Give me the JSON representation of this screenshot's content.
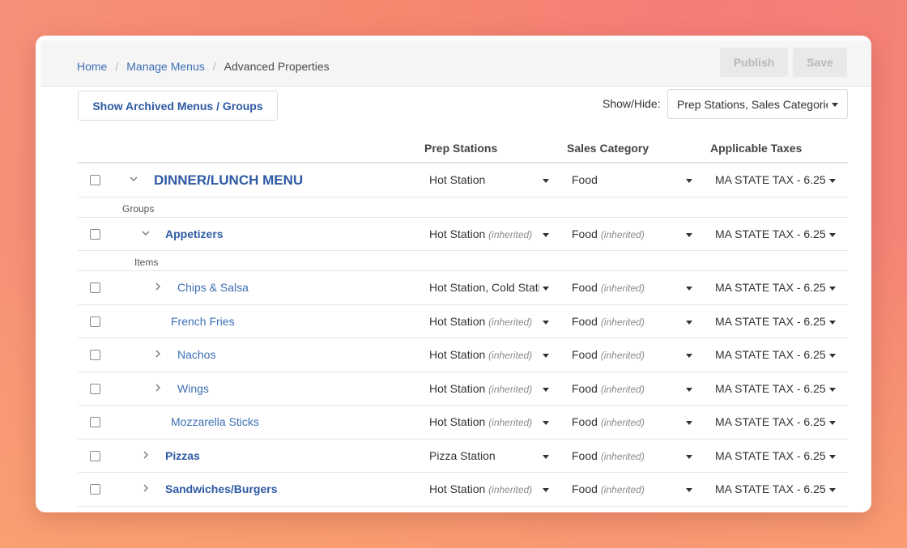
{
  "breadcrumb": {
    "home": "Home",
    "manage_menus": "Manage Menus",
    "current": "Advanced Properties",
    "separator": "/"
  },
  "toolbar": {
    "publish_label": "Publish",
    "save_label": "Save",
    "show_archived_label": "Show Archived Menus / Groups",
    "show_hide_label": "Show/Hide:",
    "show_hide_value": "Prep Stations, Sales Categories"
  },
  "columns": {
    "prep": "Prep Stations",
    "sales": "Sales Category",
    "taxes": "Applicable Taxes"
  },
  "inherited_label": "(inherited)",
  "rows": [
    {
      "type": "item",
      "level": 0,
      "name": "DINNER/LUNCH MENU",
      "chevron": "down",
      "prep": "Hot Station",
      "prep_inh": false,
      "sales": "Food",
      "sales_inh": false,
      "tax": "MA STATE TAX - 6.25%"
    },
    {
      "type": "sub",
      "level": 0,
      "label": "Groups"
    },
    {
      "type": "item",
      "level": 1,
      "name": "Appetizers",
      "chevron": "down",
      "prep": "Hot Station",
      "prep_inh": true,
      "sales": "Food",
      "sales_inh": true,
      "tax": "MA STATE TAX - 6.25%"
    },
    {
      "type": "sub",
      "level": 1,
      "label": "Items"
    },
    {
      "type": "item",
      "level": 2,
      "name": "Chips & Salsa",
      "chevron": "right",
      "prep": "Hot Station, Cold Station",
      "prep_inh": false,
      "sales": "Food",
      "sales_inh": true,
      "tax": "MA STATE TAX - 6.25%"
    },
    {
      "type": "item",
      "level": 2,
      "name": "French Fries",
      "chevron": "none",
      "prep": "Hot Station",
      "prep_inh": true,
      "sales": "Food",
      "sales_inh": true,
      "tax": "MA STATE TAX - 6.25%"
    },
    {
      "type": "item",
      "level": 2,
      "name": "Nachos",
      "chevron": "right",
      "prep": "Hot Station",
      "prep_inh": true,
      "sales": "Food",
      "sales_inh": true,
      "tax": "MA STATE TAX - 6.25%"
    },
    {
      "type": "item",
      "level": 2,
      "name": "Wings",
      "chevron": "right",
      "prep": "Hot Station",
      "prep_inh": true,
      "sales": "Food",
      "sales_inh": true,
      "tax": "MA STATE TAX - 6.25%"
    },
    {
      "type": "item",
      "level": 2,
      "name": "Mozzarella Sticks",
      "chevron": "none",
      "prep": "Hot Station",
      "prep_inh": true,
      "sales": "Food",
      "sales_inh": true,
      "tax": "MA STATE TAX - 6.25%"
    },
    {
      "type": "item",
      "level": 1,
      "name": "Pizzas",
      "chevron": "right",
      "prep": "Pizza Station",
      "prep_inh": false,
      "sales": "Food",
      "sales_inh": true,
      "tax": "MA STATE TAX - 6.25%"
    },
    {
      "type": "item",
      "level": 1,
      "name": "Sandwiches/Burgers",
      "chevron": "right",
      "prep": "Hot Station",
      "prep_inh": true,
      "sales": "Food",
      "sales_inh": true,
      "tax": "MA STATE TAX - 6.25%"
    }
  ],
  "colors": {
    "link": "#3d6fb5",
    "title_blue": "#2e5aa4",
    "background_gradient_start": "#f7907a",
    "background_gradient_end": "#f58475"
  }
}
